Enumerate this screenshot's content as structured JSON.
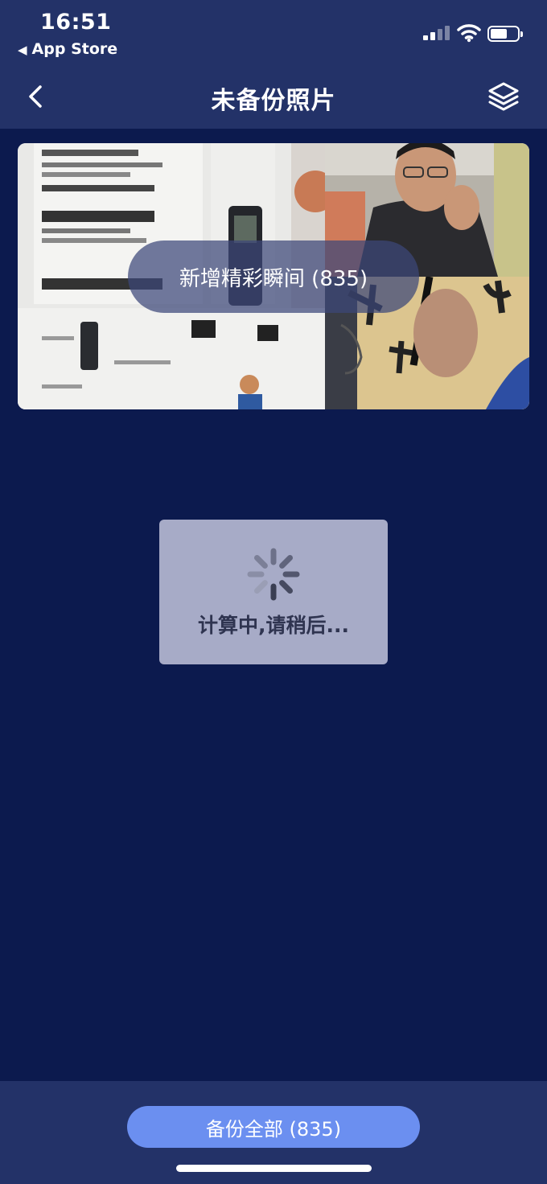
{
  "status": {
    "time": "16:51",
    "back_label": "App Store",
    "back_icon": "left-triangle-icon",
    "signal_level": 2,
    "battery_level": 0.55
  },
  "nav": {
    "title": "未备份照片",
    "back_icon": "chevron-left-icon",
    "right_icon": "layers-icon"
  },
  "banner": {
    "label": "新增精彩瞬间 (835)"
  },
  "toast": {
    "icon": "spinner-icon",
    "text": "计算中,请稍后..."
  },
  "footer": {
    "backup_all_label": "备份全部 (835)"
  },
  "colors": {
    "background": "#0c1a4e",
    "bar": "#233268",
    "button": "#6b8ff0",
    "toast": "#a7abc7"
  }
}
